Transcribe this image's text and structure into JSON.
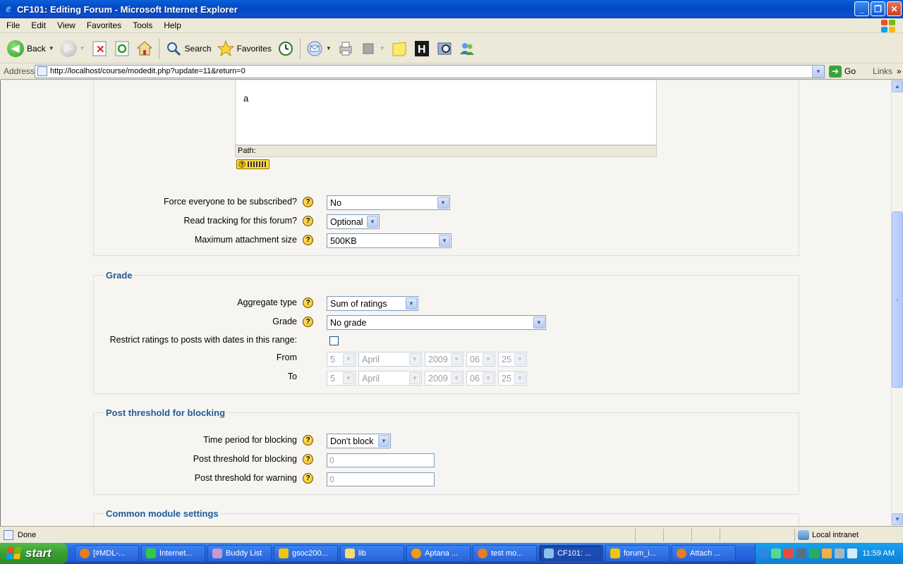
{
  "window": {
    "title": "CF101: Editing Forum - Microsoft Internet Explorer",
    "min_symbol": "_",
    "max_symbol": "❐",
    "close_symbol": "✕"
  },
  "menu": [
    "File",
    "Edit",
    "View",
    "Favorites",
    "Tools",
    "Help"
  ],
  "toolbar": {
    "back_label": "Back",
    "search_label": "Search",
    "favorites_label": "Favorites"
  },
  "address": {
    "label": "Address",
    "url": "http://localhost/course/modedit.php?update=11&return=0",
    "go_label": "Go",
    "links_label": "Links"
  },
  "editor": {
    "content": "a",
    "path_label": "Path:"
  },
  "forum_settings": {
    "force_subscribe_label": "Force everyone to be subscribed?",
    "force_subscribe_value": "No",
    "read_tracking_label": "Read tracking for this forum?",
    "read_tracking_value": "Optional",
    "max_attachment_label": "Maximum attachment size",
    "max_attachment_value": "500KB"
  },
  "grade_section": {
    "legend": "Grade",
    "aggregate_label": "Aggregate type",
    "aggregate_value": "Sum of ratings",
    "grade_label": "Grade",
    "grade_value": "No grade",
    "restrict_label": "Restrict ratings to posts with dates in this range:",
    "restrict_checked": false,
    "from_label": "From",
    "to_label": "To",
    "from": {
      "day": "5",
      "month": "April",
      "year": "2009",
      "hour": "06",
      "minute": "25"
    },
    "to": {
      "day": "5",
      "month": "April",
      "year": "2009",
      "hour": "06",
      "minute": "25"
    }
  },
  "blocking_section": {
    "legend": "Post threshold for blocking",
    "time_period_label": "Time period for blocking",
    "time_period_value": "Don't block",
    "post_threshold_label": "Post threshold for blocking",
    "post_threshold_value": "0",
    "warning_threshold_label": "Post threshold for warning",
    "warning_threshold_value": "0"
  },
  "common_section": {
    "legend": "Common module settings"
  },
  "help_symbol": "?",
  "status": {
    "text": "Done",
    "zone": "Local intranet"
  },
  "taskbar": {
    "start_label": "start",
    "tasks": [
      "[#MDL-...",
      "Internet...",
      "Buddy List",
      "gsoc200...",
      "lib",
      "Aptana ...",
      "test mo...",
      "CF101: ...",
      "forum_i...",
      "Attach ..."
    ],
    "clock": "11:59 AM"
  },
  "colors": {
    "legend": "#235a9a",
    "titlebar": "#0348c4",
    "taskbar": "#245edb",
    "start": "#3a9d33"
  }
}
